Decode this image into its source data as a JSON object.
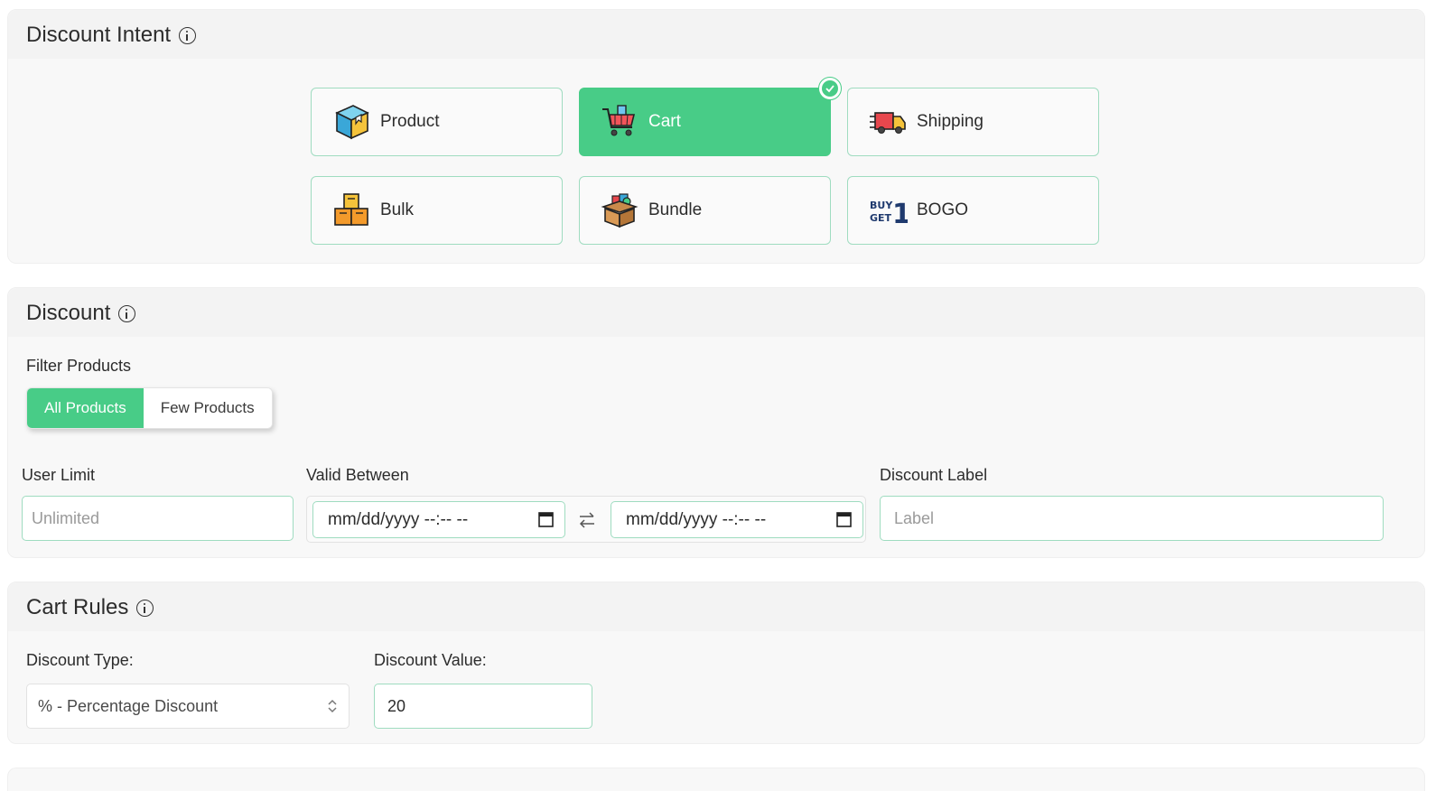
{
  "intent": {
    "title": "Discount Intent",
    "options": [
      {
        "label": "Product",
        "icon": "product-box-icon",
        "selected": false
      },
      {
        "label": "Cart",
        "icon": "shopping-cart-icon",
        "selected": true
      },
      {
        "label": "Shipping",
        "icon": "delivery-truck-icon",
        "selected": false
      },
      {
        "label": "Bulk",
        "icon": "stacked-boxes-icon",
        "selected": false
      },
      {
        "label": "Bundle",
        "icon": "bundle-box-icon",
        "selected": false
      },
      {
        "label": "BOGO",
        "icon": "buy-get-one-icon",
        "selected": false
      }
    ]
  },
  "discount": {
    "title": "Discount",
    "filter_label": "Filter Products",
    "filter_options": [
      "All Products",
      "Few Products"
    ],
    "filter_selected": "All Products",
    "user_limit_label": "User Limit",
    "user_limit_placeholder": "Unlimited",
    "valid_between_label": "Valid Between",
    "date_start_placeholder": "mm/dd/yyyy --:-- --",
    "date_end_placeholder": "mm/dd/yyyy --:-- --",
    "label_field_label": "Discount Label",
    "label_placeholder": "Label"
  },
  "cart_rules": {
    "title": "Cart Rules",
    "type_label": "Discount Type:",
    "type_value": "% - Percentage Discount",
    "value_label": "Discount Value:",
    "value": "20"
  },
  "colors": {
    "accent": "#48cc87",
    "border": "#9fdcc0"
  }
}
